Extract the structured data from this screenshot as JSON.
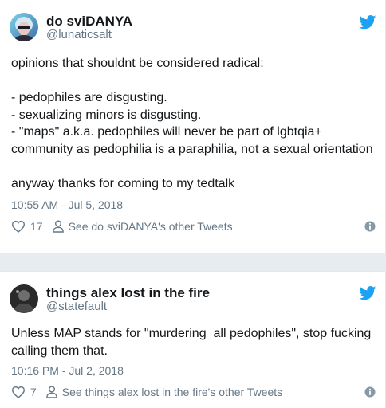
{
  "tweets": [
    {
      "display_name": "do sviDANYA",
      "handle": "@lunaticsalt",
      "body": "opinions that shouldnt be considered radical:\n\n- pedophiles are disgusting.\n- sexualizing minors is disgusting.\n- \"maps\" a.k.a. pedophiles will never be part of lgbtqia+\ncommunity as pedophilia is a paraphilia, not a sexual orientation\n\nanyway thanks for coming to my tedtalk",
      "timestamp": "10:55 AM - Jul 5, 2018",
      "likes": "17",
      "see_other": "See do sviDANYA's other Tweets"
    },
    {
      "display_name": "things alex lost in the fire",
      "handle": "@statefault",
      "body": "Unless MAP stands for \"murdering  all pedophiles\", stop fucking\ncalling them that.",
      "timestamp": "10:16 PM - Jul 2, 2018",
      "likes": "7",
      "see_other": "See things alex lost in the fire's other Tweets"
    }
  ],
  "colors": {
    "twitter_blue": "#1da1f2",
    "text_primary": "#14171a",
    "text_secondary": "#657786",
    "divider": "#e1e8ed",
    "background": "#e6ecf0"
  },
  "icons": {
    "brand": "twitter-bird-icon",
    "like": "heart-icon",
    "profile": "person-icon",
    "info": "info-icon"
  }
}
